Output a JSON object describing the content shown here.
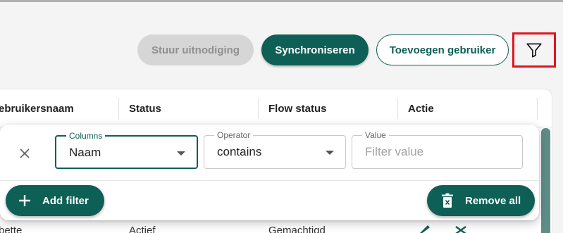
{
  "toolbar": {
    "invite_label": "Stuur uitnodiging",
    "sync_label": "Synchroniseren",
    "add_user_label": "Toevoegen gebruiker",
    "filter_icon": "filter-icon"
  },
  "table": {
    "columns": [
      "ebruikersnaam",
      "Status",
      "Flow status",
      "Actie"
    ],
    "partial_row": {
      "username": "bette",
      "status": "Actief",
      "flow_status": "Gemachtigd"
    }
  },
  "filter_panel": {
    "columns": {
      "label": "Columns",
      "value": "Naam"
    },
    "operator": {
      "label": "Operator",
      "value": "contains"
    },
    "value": {
      "label": "Value",
      "placeholder": "Filter value"
    },
    "add_filter_label": "Add filter",
    "remove_all_label": "Remove all"
  },
  "colors": {
    "primary": "#0e5f56",
    "highlight": "#e0141e",
    "disabled": "#d6d6d6"
  }
}
